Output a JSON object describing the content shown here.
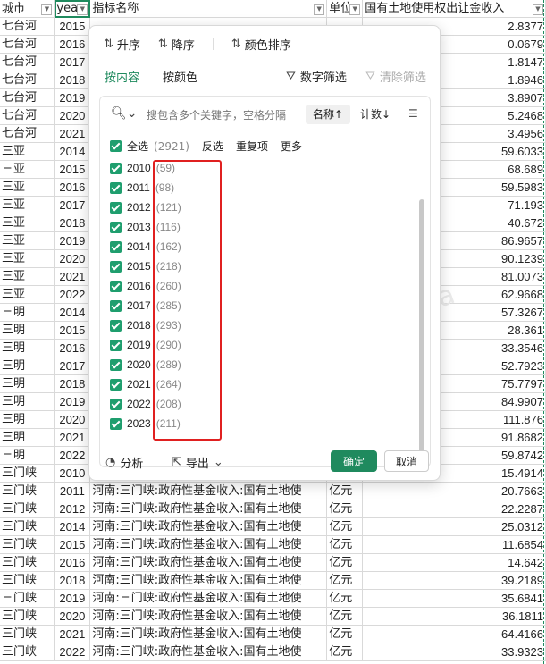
{
  "sheet": {
    "headers": [
      "城市",
      "yea",
      "指标名称",
      "单位",
      "国有土地使用权出让金收入"
    ],
    "rows": [
      [
        "七台河",
        "2015",
        "",
        "",
        "2.8377"
      ],
      [
        "七台河",
        "2016",
        "",
        "",
        "0.0679"
      ],
      [
        "七台河",
        "2017",
        "",
        "",
        "1.8147"
      ],
      [
        "七台河",
        "2018",
        "",
        "",
        "1.8946"
      ],
      [
        "七台河",
        "2019",
        "",
        "",
        "3.8907"
      ],
      [
        "七台河",
        "2020",
        "",
        "",
        "5.2468"
      ],
      [
        "七台河",
        "2021",
        "",
        "",
        "3.4956"
      ],
      [
        "三亚",
        "2014",
        "",
        "",
        "59.6033"
      ],
      [
        "三亚",
        "2015",
        "",
        "",
        "68.689"
      ],
      [
        "三亚",
        "2016",
        "",
        "",
        "59.5983"
      ],
      [
        "三亚",
        "2017",
        "",
        "",
        "71.193"
      ],
      [
        "三亚",
        "2018",
        "",
        "",
        "40.672"
      ],
      [
        "三亚",
        "2019",
        "",
        "",
        "86.9657"
      ],
      [
        "三亚",
        "2020",
        "",
        "",
        "90.1239"
      ],
      [
        "三亚",
        "2021",
        "",
        "",
        "81.0073"
      ],
      [
        "三亚",
        "2022",
        "",
        "",
        "62.9668"
      ],
      [
        "三明",
        "2014",
        "",
        "",
        "57.3267"
      ],
      [
        "三明",
        "2015",
        "",
        "",
        "28.361"
      ],
      [
        "三明",
        "2016",
        "",
        "",
        "33.3546"
      ],
      [
        "三明",
        "2017",
        "",
        "",
        "52.7923"
      ],
      [
        "三明",
        "2018",
        "",
        "",
        "75.7797"
      ],
      [
        "三明",
        "2019",
        "",
        "",
        "84.9907"
      ],
      [
        "三明",
        "2020",
        "",
        "",
        "111.876"
      ],
      [
        "三明",
        "2021",
        "",
        "",
        "91.8682"
      ],
      [
        "三明",
        "2022",
        "",
        "",
        "59.8742"
      ],
      [
        "三门峡",
        "2010",
        "",
        "",
        "15.4914"
      ],
      [
        "三门峡",
        "2011",
        "河南:三门峡:政府性基金收入:国有土地使",
        "亿元",
        "20.7663"
      ],
      [
        "三门峡",
        "2012",
        "河南:三门峡:政府性基金收入:国有土地使",
        "亿元",
        "22.2287"
      ],
      [
        "三门峡",
        "2014",
        "河南:三门峡:政府性基金收入:国有土地使",
        "亿元",
        "25.0312"
      ],
      [
        "三门峡",
        "2015",
        "河南:三门峡:政府性基金收入:国有土地使",
        "亿元",
        "11.6854"
      ],
      [
        "三门峡",
        "2016",
        "河南:三门峡:政府性基金收入:国有土地使",
        "亿元",
        "14.642"
      ],
      [
        "三门峡",
        "2018",
        "河南:三门峡:政府性基金收入:国有土地使",
        "亿元",
        "39.2189"
      ],
      [
        "三门峡",
        "2019",
        "河南:三门峡:政府性基金收入:国有土地使",
        "亿元",
        "35.6841"
      ],
      [
        "三门峡",
        "2020",
        "河南:三门峡:政府性基金收入:国有土地使",
        "亿元",
        "36.1811"
      ],
      [
        "三门峡",
        "2021",
        "河南:三门峡:政府性基金收入:国有土地使",
        "亿元",
        "64.4166"
      ],
      [
        "三门峡",
        "2022",
        "河南:三门峡:政府性基金收入:国有土地使",
        "亿元",
        "33.9323"
      ]
    ]
  },
  "popup": {
    "sort_asc": "升序",
    "sort_desc": "降序",
    "sort_color": "颜色排序",
    "tab_content": "按内容",
    "tab_color": "按颜色",
    "number_filter": "数字筛选",
    "clear_filter": "清除筛选",
    "search_placeholder": "搜包含多个关键字，空格分隔",
    "sort_by_name": "名称↑",
    "sort_by_count": "计数↓",
    "select_all_label": "全选",
    "select_all_count": "(2921)",
    "invert": "反选",
    "duplicates": "重复项",
    "more": "更多",
    "items": [
      {
        "label": "2010",
        "count": "(59)"
      },
      {
        "label": "2011",
        "count": "(98)"
      },
      {
        "label": "2012",
        "count": "(121)"
      },
      {
        "label": "2013",
        "count": "(116)"
      },
      {
        "label": "2014",
        "count": "(162)"
      },
      {
        "label": "2015",
        "count": "(218)"
      },
      {
        "label": "2016",
        "count": "(260)"
      },
      {
        "label": "2017",
        "count": "(285)"
      },
      {
        "label": "2018",
        "count": "(293)"
      },
      {
        "label": "2019",
        "count": "(290)"
      },
      {
        "label": "2020",
        "count": "(289)"
      },
      {
        "label": "2021",
        "count": "(264)"
      },
      {
        "label": "2022",
        "count": "(208)"
      },
      {
        "label": "2023",
        "count": "(211)"
      }
    ],
    "analyze": "分析",
    "export": "导出",
    "ok": "确定",
    "cancel": "取消"
  }
}
